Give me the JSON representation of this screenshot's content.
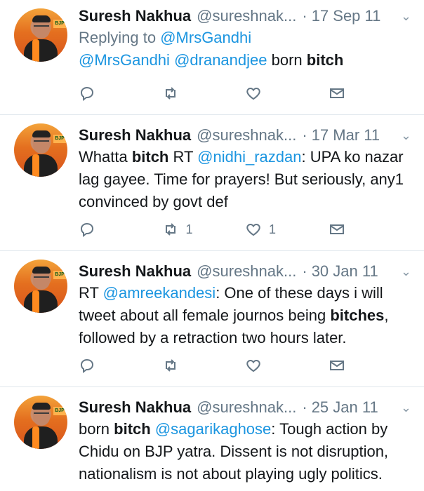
{
  "colors": {
    "link": "#1b95e0",
    "muted": "#657786",
    "text": "#14171a",
    "divider": "#e1e8ed"
  },
  "tweets": [
    {
      "name": "Suresh Nakhua",
      "handle": "@sureshnak...",
      "date": "17 Sep 11",
      "reply_prefix": "Replying to",
      "reply_to": "@MrsGandhi",
      "parts": [
        "",
        "@MrsGandhi",
        " ",
        "@dranandjee",
        " born ",
        "bitch",
        ""
      ],
      "counts": {
        "reply": "",
        "retweet": "",
        "like": ""
      }
    },
    {
      "name": "Suresh Nakhua",
      "handle": "@sureshnak...",
      "date": "17 Mar 11",
      "parts": [
        "Whatta ",
        "bitch",
        " RT ",
        "@nidhi_razdan",
        ": UPA ko nazar lag gayee. Time for prayers! But seriously, any1 convinced by govt def"
      ],
      "counts": {
        "reply": "",
        "retweet": "1",
        "like": "1"
      }
    },
    {
      "name": "Suresh Nakhua",
      "handle": "@sureshnak...",
      "date": "30 Jan 11",
      "parts": [
        "RT ",
        "@amreekandesi",
        ": One of these days i will tweet about all female journos being ",
        "bitches",
        ", followed by a retraction two hours later."
      ],
      "counts": {
        "reply": "",
        "retweet": "",
        "like": ""
      }
    },
    {
      "name": "Suresh Nakhua",
      "handle": "@sureshnak...",
      "date": "25 Jan 11",
      "parts": [
        "born ",
        "bitch",
        " ",
        "@sagarikaghose",
        ": Tough action by Chidu on BJP yatra. Dissent is not disruption, nationalism is not about playing ugly politics."
      ]
    }
  ],
  "icons": {
    "reply": "reply-icon",
    "retweet": "retweet-icon",
    "like": "heart-icon",
    "dm": "envelope-icon",
    "caret": "chevron-down-icon"
  },
  "avatar_badge": "BJP"
}
